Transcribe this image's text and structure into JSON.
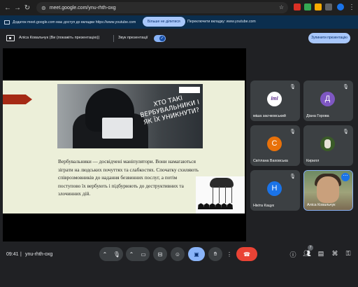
{
  "browser": {
    "url": "meet.google.com/ynu-rhth-oxg",
    "extension_colors": [
      "#d93025",
      "#34a853",
      "#f9ab00",
      "#1a73e8"
    ]
  },
  "banner": {
    "text": "Додаток meet.google.com має доступ до вкладки https://www.youtube.com",
    "stop_label": "Більше не ділитися",
    "switch_label": "Переключити вкладку: www.youtube.com"
  },
  "meet": {
    "presenter_label": "Аліса Ковальчук (Ви (покажіть презентацію))",
    "audio_label": "Звук презентації",
    "stop_presenting_label": "Зупинити презентацію",
    "accent": "#8ab4f8",
    "end_call_color": "#ea4335"
  },
  "slide": {
    "title": "ХТО ТАКІ ВЕРБУВАЛЬНИКИ І ЯК ЇХ УНИКНУТИ?",
    "body": "Вербувальники — досвідчені маніпулятори. Вони намагаються зіграти на людських почуттях та слабкостях. Спочатку схиляють співрозмовників до надання безвинних послуг, а потім поступово їх вербують і підбурюють до деструктивних та злочинних дій."
  },
  "participants": [
    {
      "name": "міша заєчковський",
      "avatar": "lml",
      "avatar_color": "#ffffff",
      "muted": true
    },
    {
      "name": "Діана Горова",
      "avatar": "Д",
      "avatar_color": "#7e57c2",
      "muted": true
    },
    {
      "name": "Світлана Ваховська",
      "avatar": "С",
      "avatar_color": "#e8710a",
      "muted": true
    },
    {
      "name": "Кирилл",
      "avatar": "",
      "avatar_color": "#3a5b28",
      "muted": true
    },
    {
      "name": "Нікіта Кацук",
      "avatar": "Н",
      "avatar_color": "#1a73e8",
      "muted": true
    },
    {
      "name": "Аліса Ковальчук",
      "avatar": "",
      "avatar_color": "#8a9a6a",
      "muted": false
    }
  ],
  "bottom": {
    "time": "09:41",
    "meeting_code": "ynu-rhth-oxg",
    "people_count": "7"
  },
  "icons": {
    "mic": "mic-icon",
    "camera": "camera-icon",
    "captions": "captions-icon",
    "emoji": "emoji-icon",
    "present": "present-icon",
    "raise_hand": "raise-hand-icon",
    "more": "more-options-icon",
    "end_call": "end-call-icon",
    "info": "info-icon",
    "people": "people-icon",
    "chat": "chat-icon",
    "activities": "activities-icon",
    "host_controls": "host-controls-icon"
  }
}
